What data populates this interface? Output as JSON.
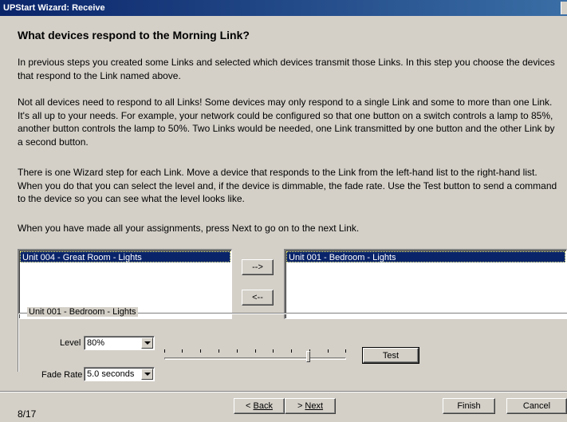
{
  "window": {
    "title": "UPStart Wizard: Receive"
  },
  "heading": "What devices respond to the Morning Link?",
  "paragraphs": [
    "In previous steps you created some Links and selected which devices transmit those Links. In this step you choose the devices that respond to the Link named above.",
    "Not all devices need to respond to all Links! Some devices may only respond to a single Link and some to more than one Link. It's all up to your needs. For example, your network could be configured so that one button on a switch controls a lamp to 85%, another button controls the lamp to 50%. Two Links would be needed, one Link transmitted by one button and the other Link by a second button.",
    "There is one Wizard step for each Link. Move a device that responds to the Link from the left-hand list to the right-hand list. When you do that you can select the level and, if the device is dimmable, the fade rate. Use the Test button to send a command to the device so you can see what the level looks like.",
    "When you have made all your assignments, press Next to go on to the next Link."
  ],
  "left_list": {
    "items": [
      "Unit 004 - Great Room - Lights"
    ]
  },
  "right_list": {
    "items": [
      "Unit 001 - Bedroom - Lights"
    ]
  },
  "move_buttons": {
    "add": "-->",
    "remove": "<--"
  },
  "settings": {
    "group_label": "Unit 001 - Bedroom - Lights",
    "level_label": "Level",
    "level_value": "80%",
    "level_fraction": 0.8,
    "fade_label": "Fade Rate",
    "fade_value": "5.0 seconds",
    "test_label": "Test"
  },
  "footer": {
    "step": "8/17",
    "back": "Back",
    "back_prefix": "< ",
    "next": "Next",
    "next_prefix": "> ",
    "finish": "Finish",
    "cancel": "Cancel"
  }
}
